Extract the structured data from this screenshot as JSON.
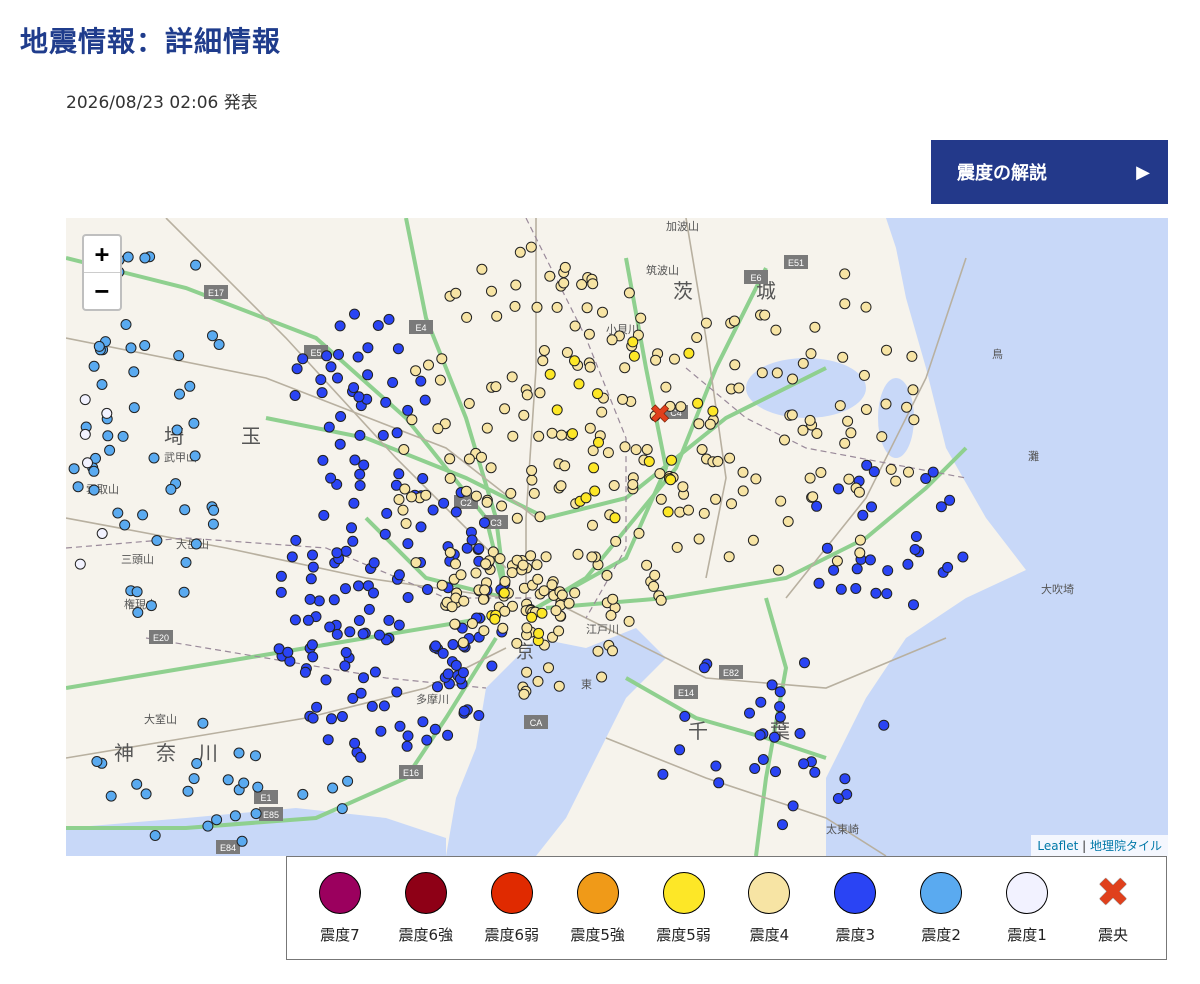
{
  "header": {
    "title": "地震情報：詳細情報",
    "issued": "2026/08/23 02:06 発表"
  },
  "explain_button": {
    "label": "震度の解説",
    "arrow": "▶"
  },
  "map": {
    "zoom_in": "+",
    "zoom_out": "−",
    "attribution": {
      "leaflet": "Leaflet",
      "separator": "|",
      "tiles": "地理院タイル"
    },
    "place_labels": [
      "茨",
      "城",
      "埼",
      "玉",
      "神",
      "奈",
      "川",
      "千",
      "葉",
      "京",
      "東",
      "鳥",
      "灘",
      "加波山",
      "筑波山",
      "武甲山",
      "雲取山",
      "大岳山",
      "三頭山",
      "権現山",
      "大室山",
      "小貝川",
      "江戸川",
      "多摩川",
      "大吹埼",
      "太東崎"
    ],
    "route_labels": [
      "E17",
      "E4",
      "E6",
      "E51",
      "C4",
      "E14",
      "E16",
      "E1",
      "E85",
      "E84",
      "E20",
      "E82",
      "CA",
      "C2",
      "E5",
      "C3"
    ],
    "epicenter_marker": "✖"
  },
  "legend": {
    "items": [
      {
        "label": "震度7",
        "color": "#9b005e"
      },
      {
        "label": "震度6強",
        "color": "#8e0016"
      },
      {
        "label": "震度6弱",
        "color": "#e02a00"
      },
      {
        "label": "震度5強",
        "color": "#f09a18"
      },
      {
        "label": "震度5弱",
        "color": "#fde727"
      },
      {
        "label": "震度4",
        "color": "#f7e4a4"
      },
      {
        "label": "震度3",
        "color": "#2a44f4"
      },
      {
        "label": "震度2",
        "color": "#5aaaf0"
      },
      {
        "label": "震度1",
        "color": "#f2f2ff"
      }
    ],
    "epicenter": {
      "label": "震央",
      "icon": "cross-icon"
    }
  },
  "colors": {
    "title": "#1f3c8c",
    "button": "#23398a",
    "sea": "#c8d8f8",
    "land": "#f6f3ec",
    "expressway": "#8fd08f"
  }
}
